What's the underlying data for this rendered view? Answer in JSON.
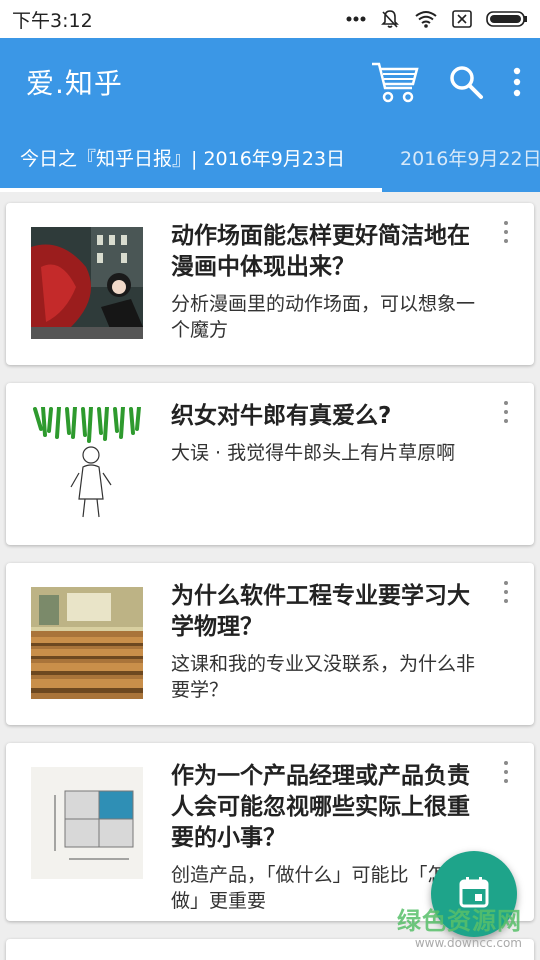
{
  "status_bar": {
    "time": "下午3:12",
    "icons": [
      "signal-dots-icon",
      "mute-bell-icon",
      "wifi-icon",
      "sim-x-icon",
      "battery-icon"
    ]
  },
  "app_bar": {
    "title": "爱.知乎",
    "actions": [
      "cart-icon",
      "search-icon",
      "overflow-menu-icon"
    ]
  },
  "tabs": [
    {
      "label": "今日之『知乎日报』| 2016年9月23日",
      "active": true
    },
    {
      "label": "2016年9月22日",
      "active": false
    }
  ],
  "cards": [
    {
      "title": "动作场面能怎样更好简洁地在漫画中体现出来？",
      "excerpt": "分析漫画里的动作场面，可以想象一个魔方"
    },
    {
      "title": "织女对牛郎有真爱么?",
      "excerpt": "大误 · 我觉得牛郎头上有片草原啊"
    },
    {
      "title": "为什么软件工程专业要学习大学物理？",
      "excerpt": "这课和我的专业又没联系，为什么非要学？"
    },
    {
      "title": "作为一个产品经理或产品负责人会可能忽视哪些实际上很重要的小事？",
      "excerpt": "创造产品，「做什么」可能比「怎么做」更重要"
    }
  ],
  "fab": {
    "icon": "calendar-icon"
  },
  "watermark": {
    "text": "绿色资源网",
    "url": "www.downcc.com"
  },
  "colors": {
    "primary": "#3b97e6",
    "fab": "#1ea48a",
    "background": "#eeeeee"
  }
}
